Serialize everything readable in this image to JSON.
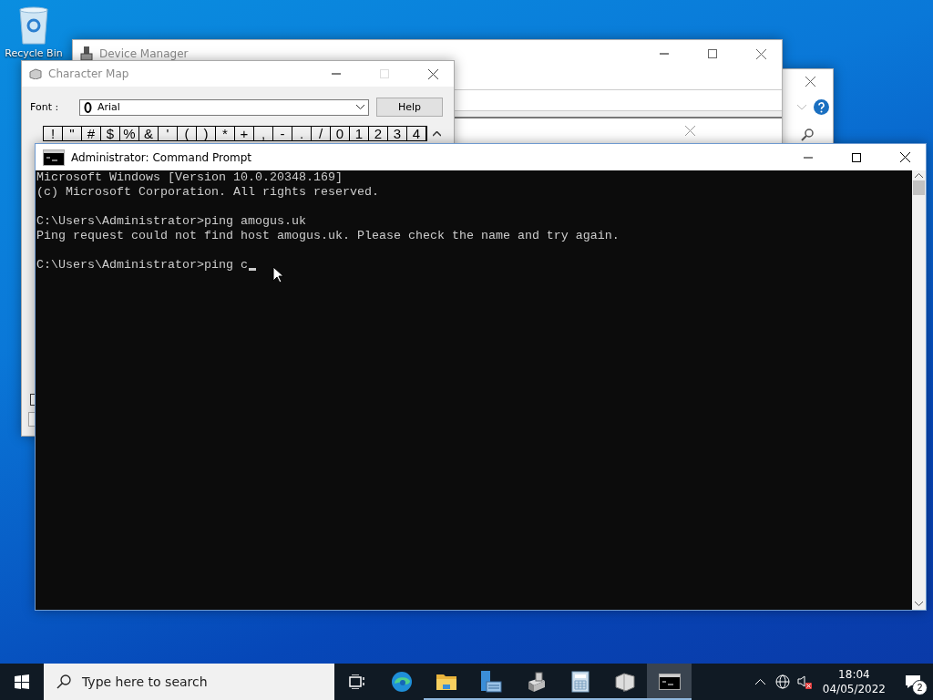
{
  "desktop": {
    "icons": [
      {
        "label": "Recycle Bin"
      }
    ]
  },
  "windows": {
    "device_manager": {
      "title": "Device Manager"
    },
    "character_map": {
      "title": "Character Map",
      "font_label": "Font :",
      "font_value": "Arial",
      "help_button": "Help",
      "characters": [
        "!",
        "\"",
        "#",
        "$",
        "%",
        "&",
        "'",
        "(",
        ")",
        "*",
        "+",
        ",",
        "-",
        ".",
        "/",
        "0",
        "1",
        "2",
        "3",
        "4"
      ]
    },
    "command_prompt": {
      "title": "Administrator: Command Prompt",
      "cursor_visible": true,
      "blocks": [
        [
          "Microsoft Windows [Version 10.0.20348.169]",
          "(c) Microsoft Corporation. All rights reserved."
        ],
        [
          "C:\\Users\\Administrator>ping amogus.uk",
          "Ping request could not find host amogus.uk. Please check the name and try again."
        ],
        [
          "C:\\Users\\Administrator>ping c"
        ]
      ]
    }
  },
  "taskbar": {
    "search_placeholder": "Type here to search",
    "apps": [
      {
        "kind": "task-view",
        "running": false,
        "selected": false
      },
      {
        "kind": "browser",
        "running": false,
        "selected": false
      },
      {
        "kind": "folder",
        "running": true,
        "selected": false
      },
      {
        "kind": "server",
        "running": true,
        "selected": false
      },
      {
        "kind": "drive",
        "running": true,
        "selected": false
      },
      {
        "kind": "calculator",
        "running": true,
        "selected": false
      },
      {
        "kind": "charmap",
        "running": true,
        "selected": false
      },
      {
        "kind": "console",
        "running": true,
        "selected": true
      }
    ],
    "clock": {
      "time": "18:04",
      "date": "04/05/2022"
    },
    "notification_count": "2"
  }
}
